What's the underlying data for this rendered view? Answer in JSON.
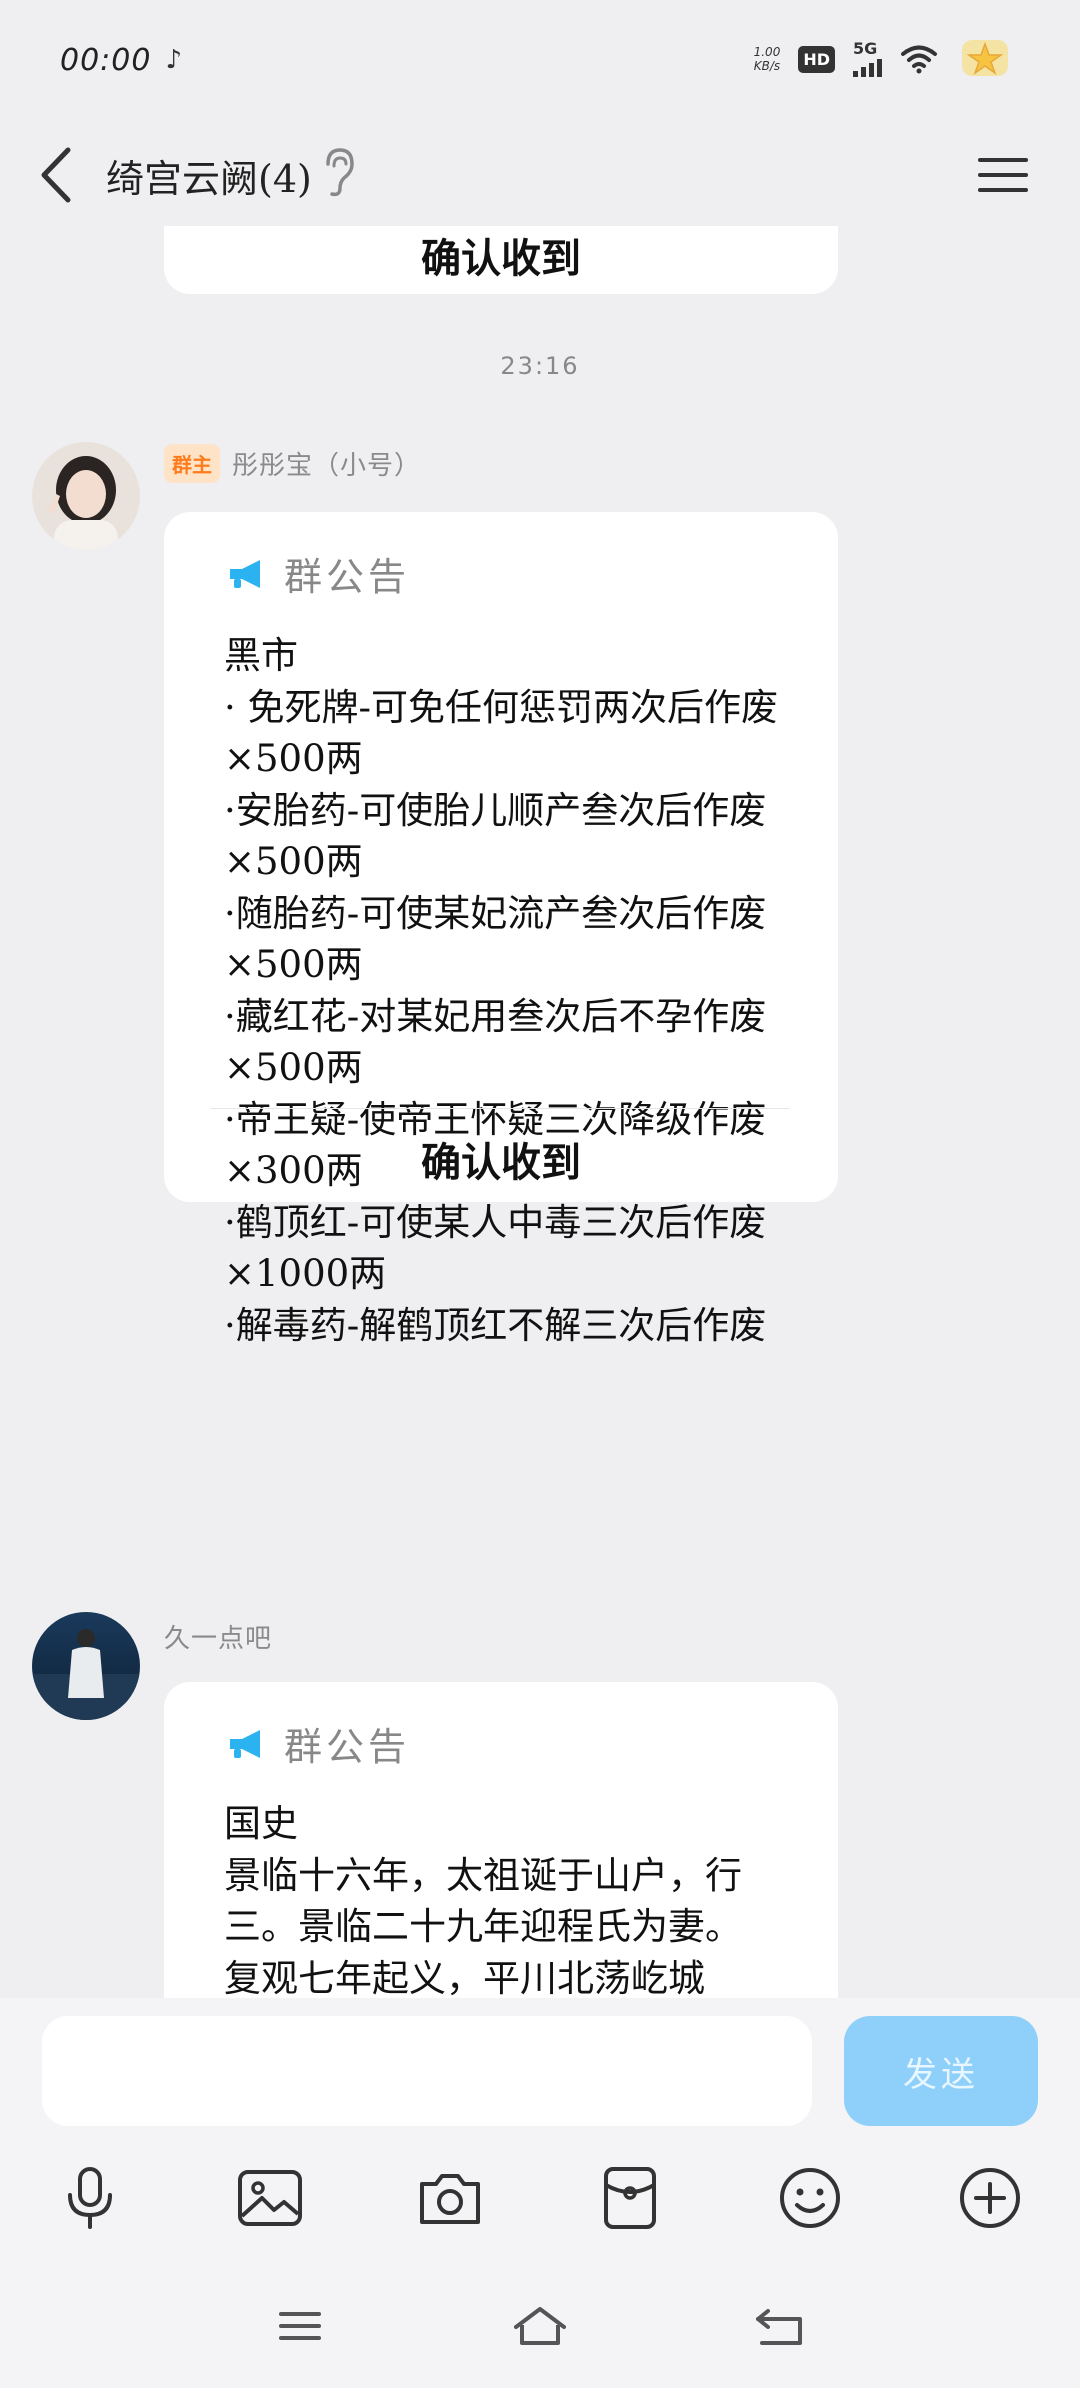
{
  "status_bar": {
    "time": "00:00",
    "net_speed_value": "1.00",
    "net_speed_unit": "KB/s",
    "hd": "HD",
    "network": "5G"
  },
  "header": {
    "title": "绮宫云阙(4)"
  },
  "chat": {
    "prev_card_confirm": "确认收到",
    "timestamp": "23:16",
    "messages": [
      {
        "badge": "群主",
        "sender": "彤彤宝（小号）",
        "notice_label": "群公告",
        "lines": [
          "黑市",
          "· 免死牌-可免任何惩罚两次后作废×500两",
          "·安胎药-可使胎儿顺产叁次后作废 ×500两",
          "·随胎药-可使某妃流产叁次后作废×500两",
          "·藏红花-对某妃用叁次后不孕作废×500两",
          "·帝王疑-使帝王怀疑三次降级作废×300两",
          "·鹤顶红-可使某人中毒三次后作废×1000两",
          "·解毒药-解鹤顶红不解三次后作废"
        ],
        "confirm": "确认收到"
      },
      {
        "sender": "久一点吧",
        "notice_label": "群公告",
        "lines": [
          "国史",
          "景临十六年，太祖诞于山户，行三。景临二十九年迎程氏为妻。",
          "复观七年起义，平川北荡屹城"
        ]
      }
    ]
  },
  "composer": {
    "input_value": "",
    "send_label": "发送"
  },
  "colors": {
    "background": "#efeff1",
    "send_button": "#8fd0fb",
    "owner_badge_bg": "#ffe3c6",
    "owner_badge_text": "#ff7b1c",
    "megaphone": "#2ab3f0"
  },
  "icons": {
    "toolbar": [
      "microphone-icon",
      "image-icon",
      "camera-icon",
      "red-packet-icon",
      "emoji-icon",
      "plus-icon"
    ],
    "navbar": [
      "menu-nav-icon",
      "home-nav-icon",
      "back-nav-icon"
    ]
  }
}
